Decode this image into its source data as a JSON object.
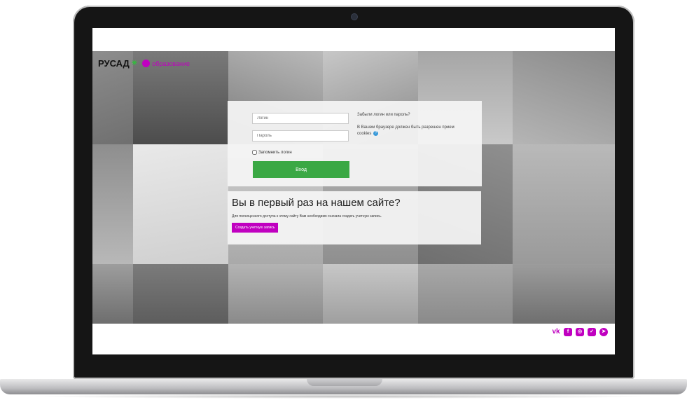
{
  "brand": {
    "name": "РУСАД",
    "sub": "образование"
  },
  "login": {
    "username_placeholder": "Логин",
    "password_placeholder": "Пароль",
    "remember_label": "Запомнить логин",
    "login_button": "Вход",
    "forgot_link": "Забыли логин или пароль?",
    "cookies_note": "В Вашем браузере должен быть разрешен прием cookies"
  },
  "signup": {
    "heading": "Вы в первый раз на нашем сайте?",
    "text": "Для полноценного доступа к этому сайту Вам необходимо сначала создать учетную запись.",
    "button": "Создать учетную запись"
  },
  "social": {
    "items": [
      "vk",
      "facebook",
      "instagram",
      "twitter",
      "telegram"
    ]
  },
  "colors": {
    "accent": "#c000c0",
    "login_button": "#3aa844",
    "brand_leaf": "#2fbf3a"
  }
}
